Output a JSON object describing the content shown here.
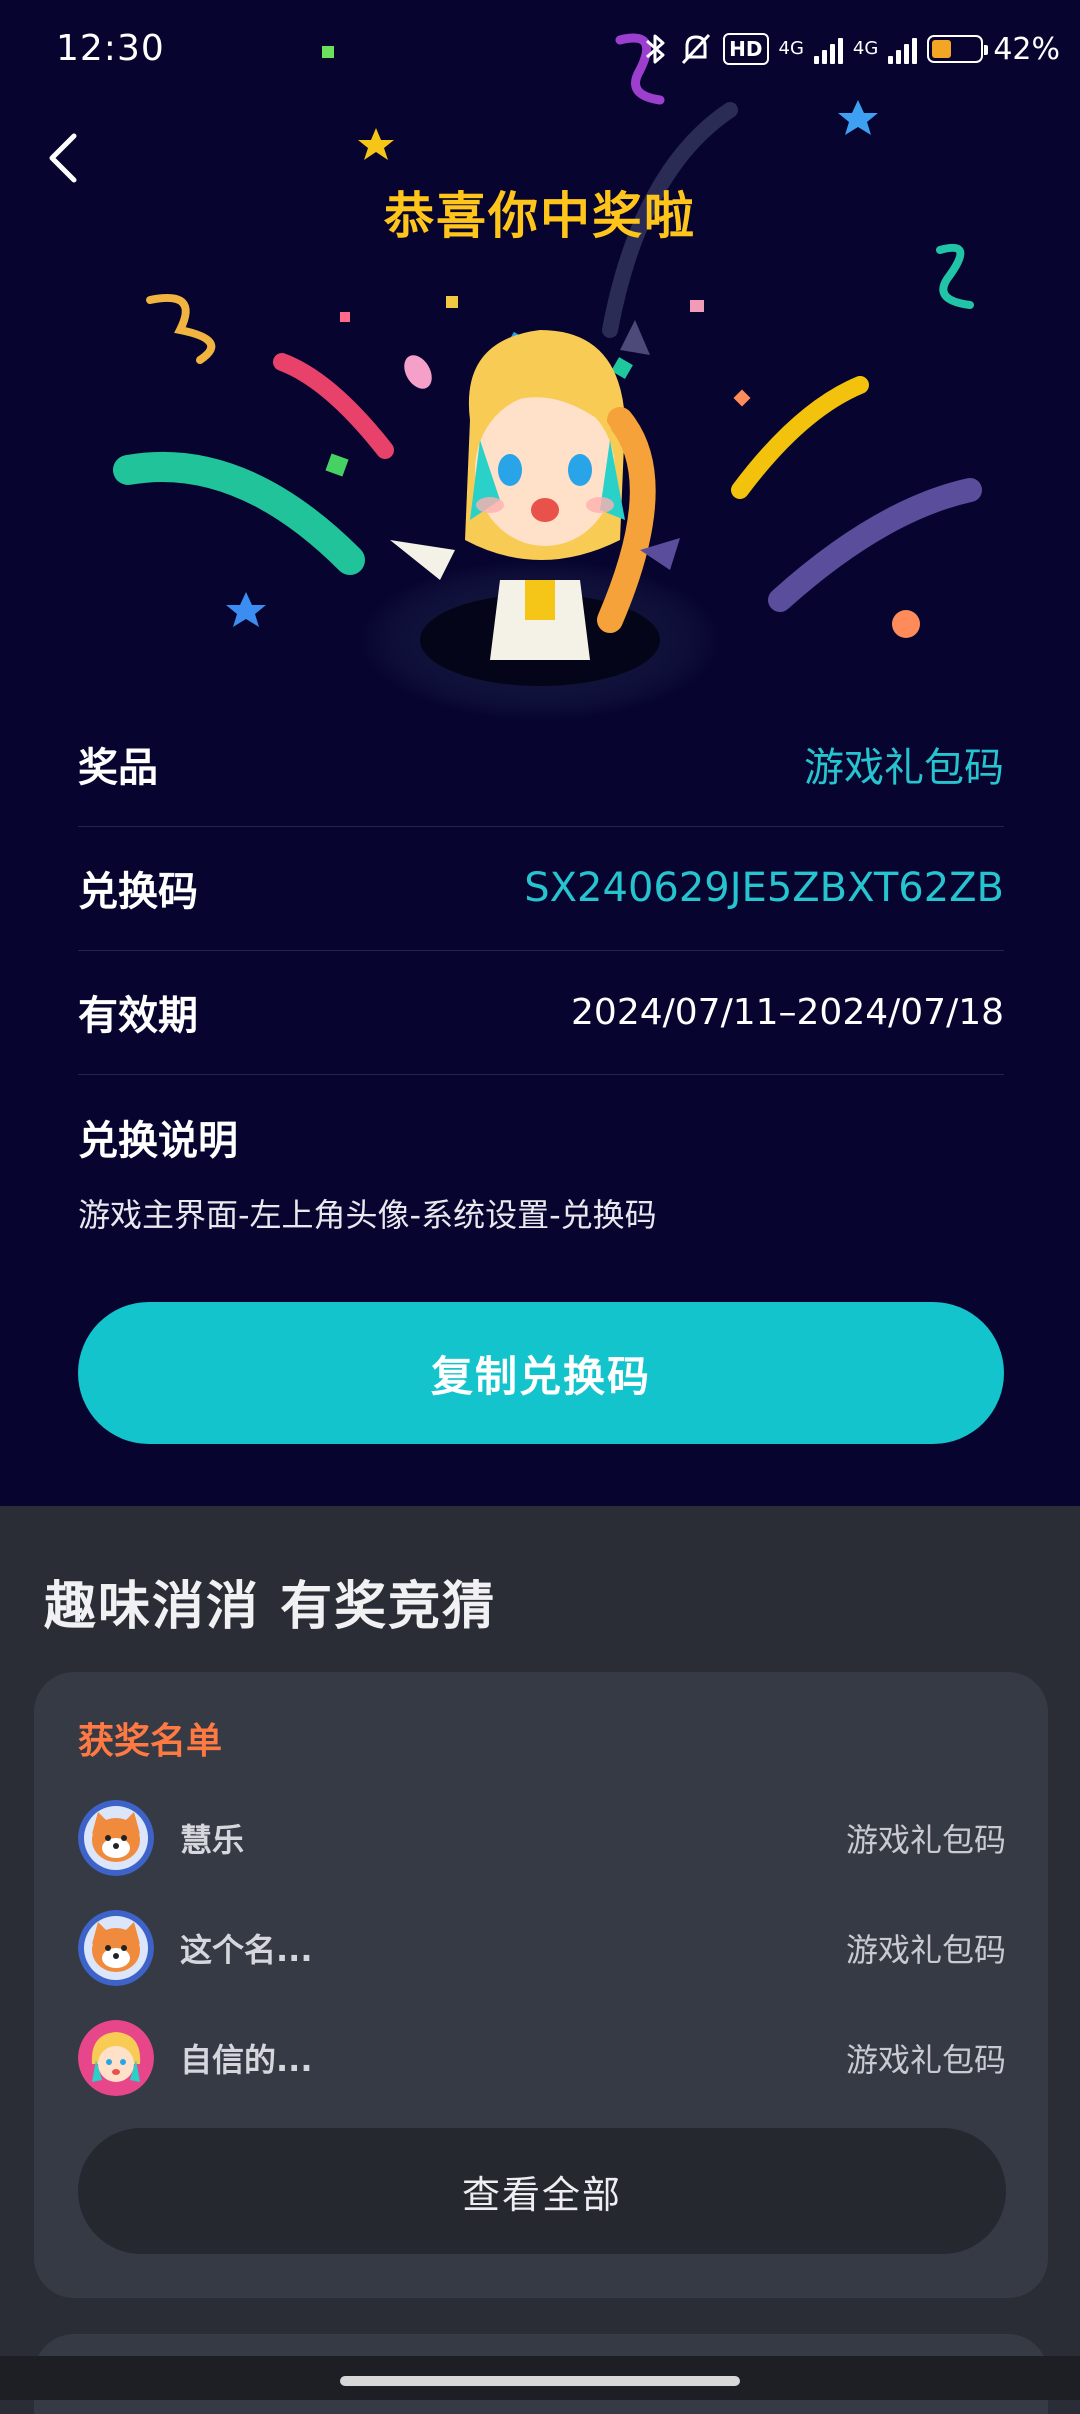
{
  "status_bar": {
    "time": "12:30",
    "hd_label": "HD",
    "network_1": "4G",
    "network_2": "4G",
    "battery_percent": "42%",
    "battery_level": 0.42
  },
  "header": {
    "title": "恭喜你中奖啦"
  },
  "prize": {
    "rows": [
      {
        "label": "奖品",
        "value": "游戏礼包码"
      },
      {
        "label": "兑换码",
        "value": "SX240629JE5ZBXT62ZB"
      },
      {
        "label": "有效期",
        "value": "2024/07/11–2024/07/18"
      }
    ],
    "instructions_title": "兑换说明",
    "instructions_text": "游戏主界面-左上角头像-系统设置-兑换码",
    "copy_button": "复制兑换码"
  },
  "section": {
    "title": "趣味消消 有奖竞猜"
  },
  "winners": {
    "title": "获奖名单",
    "items": [
      {
        "name": "慧乐",
        "prize": "游戏礼包码",
        "avatar": "shiba-avatar"
      },
      {
        "name": "这个名...",
        "prize": "游戏礼包码",
        "avatar": "shiba-avatar"
      },
      {
        "name": "自信的...",
        "prize": "游戏礼包码",
        "avatar": "girl-avatar"
      }
    ],
    "view_all": "查看全部"
  },
  "colors": {
    "hero_bg": "#070530",
    "accent": "#13c4cc",
    "title_yellow": "#ffc51a",
    "winner_title": "#ff7a42"
  }
}
